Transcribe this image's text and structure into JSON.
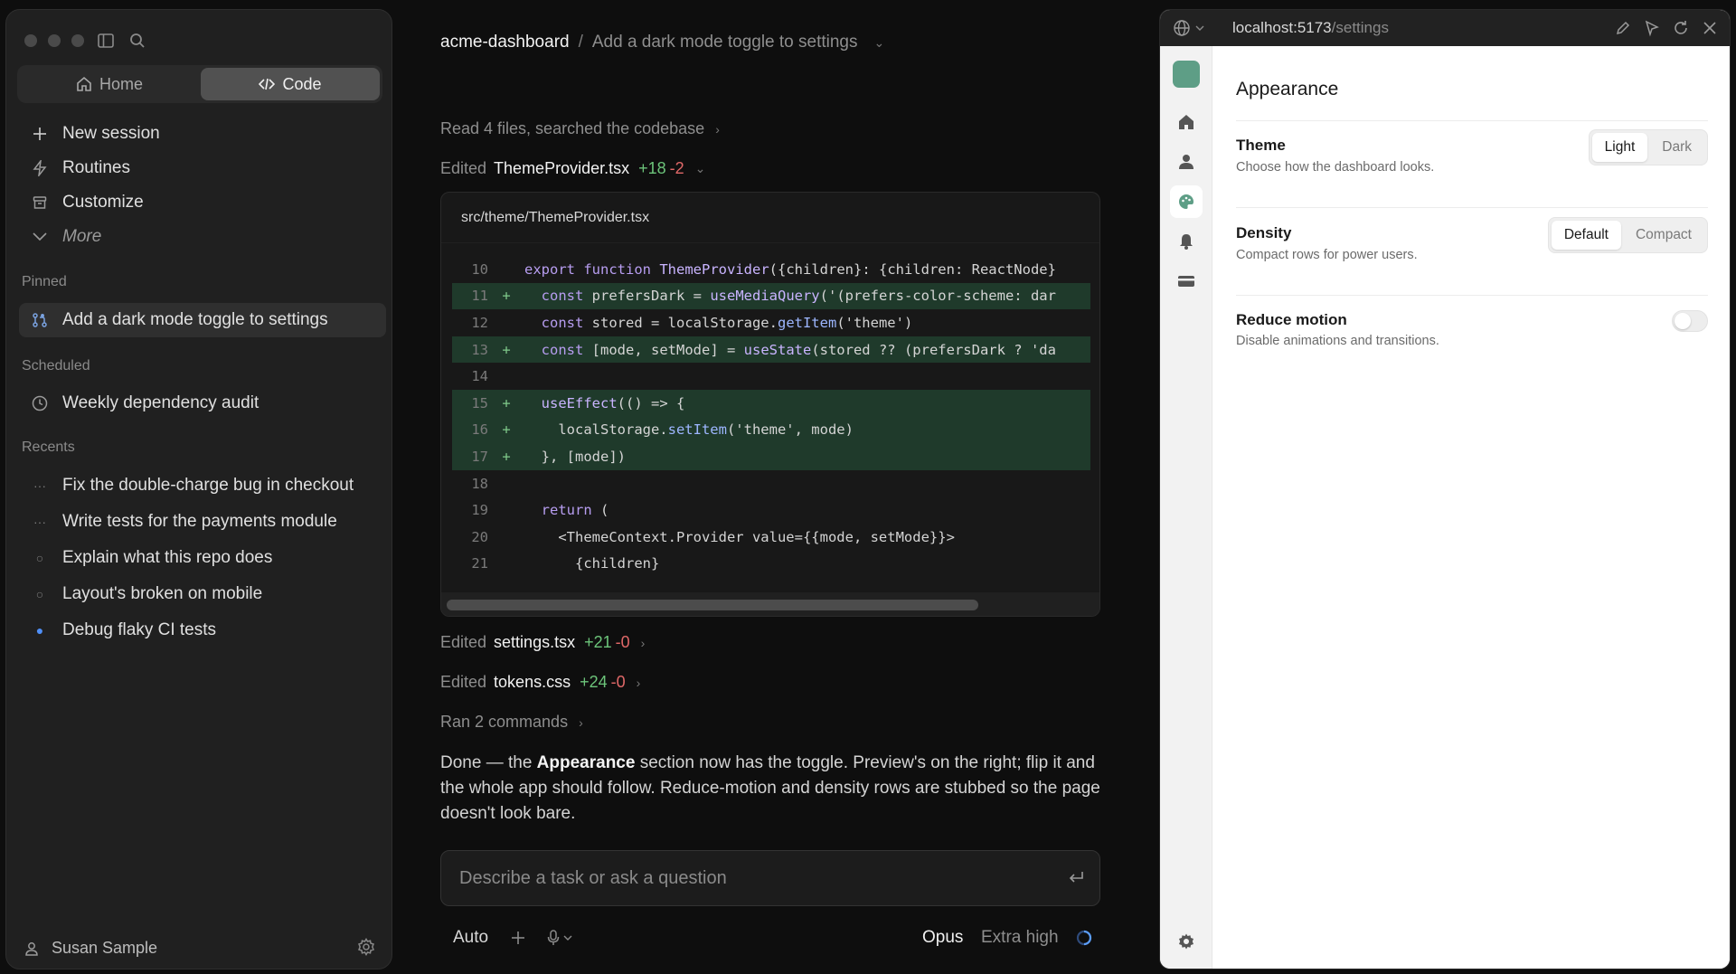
{
  "sidebar": {
    "mode_tabs": [
      {
        "label": "Home",
        "icon": "home-icon",
        "active": false
      },
      {
        "label": "Code",
        "icon": "code-icon",
        "active": true
      }
    ],
    "actions": [
      {
        "label": "New session",
        "icon": "plus-icon"
      },
      {
        "label": "Routines",
        "icon": "bolt-icon"
      },
      {
        "label": "Customize",
        "icon": "archive-icon"
      },
      {
        "label": "More",
        "icon": "chevron-down-icon"
      }
    ],
    "pinned_label": "Pinned",
    "pinned": [
      {
        "label": "Add a dark mode toggle to settings",
        "icon": "branch-icon"
      }
    ],
    "scheduled_label": "Scheduled",
    "scheduled": [
      {
        "label": "Weekly dependency audit",
        "icon": "clock-icon"
      }
    ],
    "recents_label": "Recents",
    "recents": [
      {
        "label": "Fix the double-charge bug in checkout",
        "status": "running"
      },
      {
        "label": "Write tests for the payments module",
        "status": "running"
      },
      {
        "label": "Explain what this repo does",
        "status": "idle"
      },
      {
        "label": "Layout's broken on mobile",
        "status": "idle"
      },
      {
        "label": "Debug flaky CI tests",
        "status": "unread"
      }
    ],
    "user_name": "Susan Sample"
  },
  "center": {
    "breadcrumb": {
      "project": "acme-dashboard",
      "separator": "/",
      "task": "Add a dark mode toggle to settings"
    },
    "activity_read": "Read 4 files, searched the codebase",
    "edit_main": {
      "prefix": "Edited",
      "file": "ThemeProvider.tsx",
      "added": "+18",
      "removed": "-2"
    },
    "code": {
      "path": "src/theme/ThemeProvider.tsx",
      "lines": [
        {
          "n": "10",
          "sign": "",
          "text": "export function ThemeProvider({children}: {children: ReactNode}",
          "added": false
        },
        {
          "n": "11",
          "sign": "+",
          "text": "  const prefersDark = useMediaQuery('(prefers-color-scheme: dar",
          "added": true
        },
        {
          "n": "12",
          "sign": "",
          "text": "  const stored = localStorage.getItem('theme')",
          "added": false
        },
        {
          "n": "13",
          "sign": "+",
          "text": "  const [mode, setMode] = useState(stored ?? (prefersDark ? 'da",
          "added": true
        },
        {
          "n": "14",
          "sign": "",
          "text": "",
          "added": false
        },
        {
          "n": "15",
          "sign": "+",
          "text": "  useEffect(() => {",
          "added": true
        },
        {
          "n": "16",
          "sign": "+",
          "text": "    localStorage.setItem('theme', mode)",
          "added": true
        },
        {
          "n": "17",
          "sign": "+",
          "text": "  }, [mode])",
          "added": true
        },
        {
          "n": "18",
          "sign": "",
          "text": "",
          "added": false
        },
        {
          "n": "19",
          "sign": "",
          "text": "  return (",
          "added": false
        },
        {
          "n": "20",
          "sign": "",
          "text": "    <ThemeContext.Provider value={{mode, setMode}}>",
          "added": false
        },
        {
          "n": "21",
          "sign": "",
          "text": "      {children}",
          "added": false
        }
      ]
    },
    "edit_settings": {
      "prefix": "Edited",
      "file": "settings.tsx",
      "added": "+21",
      "removed": "-0"
    },
    "edit_tokens": {
      "prefix": "Edited",
      "file": "tokens.css",
      "added": "+24",
      "removed": "-0"
    },
    "ran_commands": "Ran 2 commands",
    "message": {
      "before": "Done — the ",
      "bold": "Appearance",
      "after": " section now has the toggle. Preview's on the right; flip it and the whole app should follow. Reduce-motion and density rows are stubbed so the page doesn't look bare."
    },
    "input_placeholder": "Describe a task or ask a question",
    "bottom": {
      "mode": "Auto",
      "model": "Opus",
      "effort": "Extra high"
    }
  },
  "preview": {
    "url_host": "localhost:5173",
    "url_path": "/settings",
    "title": "Appearance",
    "theme": {
      "title": "Theme",
      "desc": "Choose how the dashboard looks.",
      "options": [
        "Light",
        "Dark"
      ],
      "selected": "Light"
    },
    "density": {
      "title": "Density",
      "desc": "Compact rows for power users.",
      "options": [
        "Default",
        "Compact"
      ],
      "selected": "Default"
    },
    "motion": {
      "title": "Reduce motion",
      "desc": "Disable animations and transitions.",
      "enabled": false
    },
    "accent_color": "#5e9e86"
  }
}
